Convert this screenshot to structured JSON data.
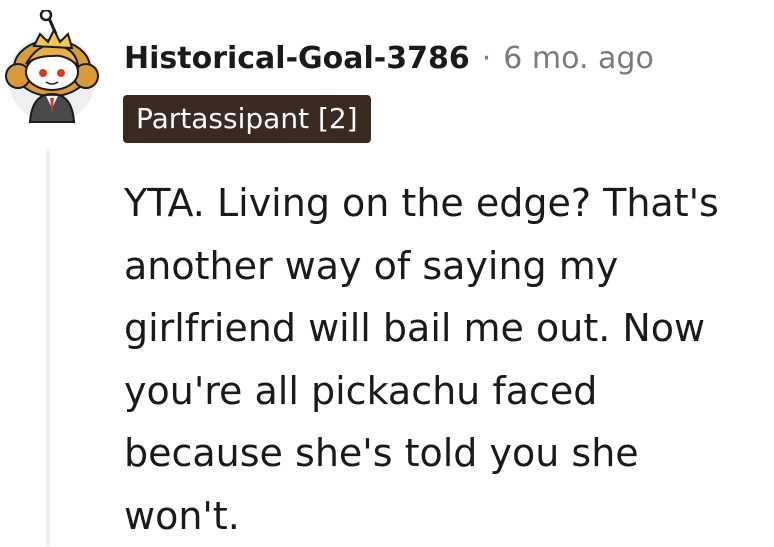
{
  "comment": {
    "author": "Historical-Goal-3786",
    "separator": "·",
    "timestamp": "6 mo. ago",
    "flair": "Partassipant [2]",
    "avatar_icon": "snoo-avatar-icon",
    "body_lines": [
      "YTA. Living on the edge? That's",
      "another way of saying my",
      "girlfriend will bail me out. Now",
      "you're all pickachu faced",
      "because she's told you she",
      "won't."
    ]
  },
  "colors": {
    "flair_background": "#3b2a22",
    "meta_text": "#787c7e",
    "thread_line": "#edeff1"
  }
}
